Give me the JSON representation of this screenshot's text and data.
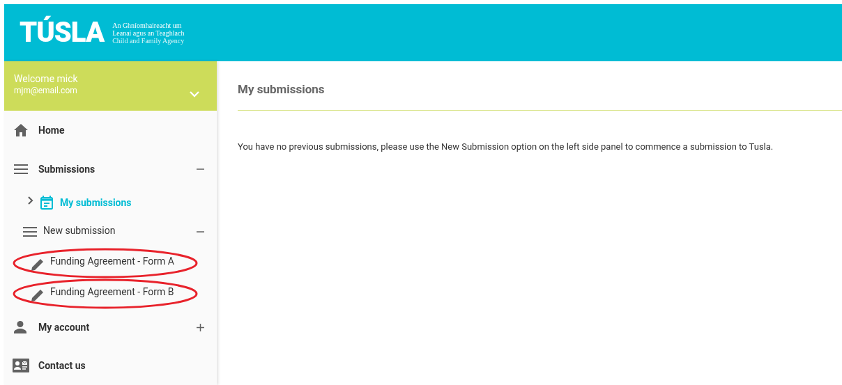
{
  "header": {
    "logo": "TÚSLA",
    "tagline": [
      "An Ghníomhaireacht um",
      "Leanaí agus an Teaghlach",
      "Child and Family Agency"
    ]
  },
  "user": {
    "welcome": "Welcome mick",
    "email": "mjm@email.com",
    "expanded": false
  },
  "nav": [
    {
      "label": "Home",
      "kind": "home",
      "bold": true,
      "circled": false
    },
    {
      "label": "Submissions",
      "kind": "menu",
      "bold": true,
      "expanded": true,
      "circled": false,
      "children": [
        {
          "label": "My submissions",
          "kind": "calendar",
          "selected": true,
          "circled": false
        },
        {
          "label": "New submission",
          "kind": "submenu",
          "expanded": true,
          "circled": false,
          "children": [
            {
              "label": "Funding Agreement - Form A",
              "kind": "pencil",
              "circled": true
            },
            {
              "label": "Funding Agreement - Form B",
              "kind": "pencil",
              "circled": true
            }
          ]
        }
      ]
    },
    {
      "label": "My account",
      "kind": "person",
      "bold": true,
      "expanded": false,
      "circled": false
    },
    {
      "label": "Contact us",
      "kind": "contact",
      "bold": true,
      "circled": false
    }
  ],
  "main": {
    "title": "My submissions",
    "message": "You have no previous submissions, please use the New Submission option on the left side panel to commence a submission to Tusla."
  }
}
